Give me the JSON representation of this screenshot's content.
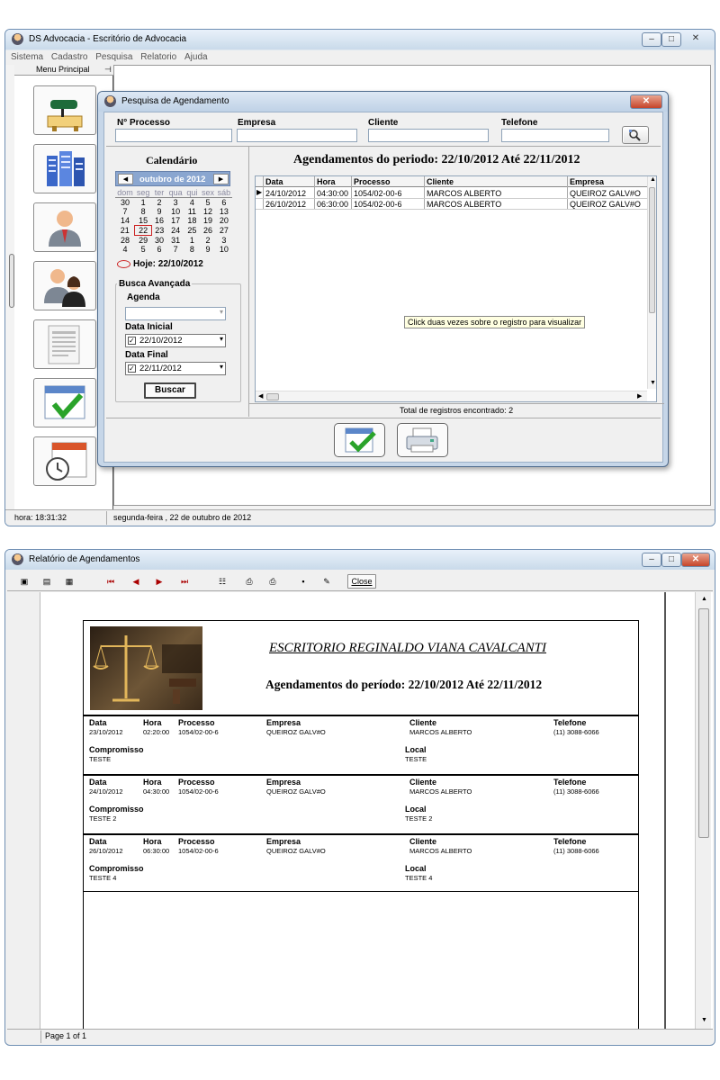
{
  "app": {
    "title": "DS Advocacia - Escritório de Advocacia",
    "menu": [
      "Sistema",
      "Cadastro",
      "Pesquisa",
      "Relatorio",
      "Ajuda"
    ],
    "side_panel_title": "Menu Principal",
    "pin": "⊣",
    "side_icons": [
      "desk-lamp-icon",
      "buildings-icon",
      "user-man-icon",
      "user-couple-icon",
      "document-icon",
      "calendar-check-icon",
      "calendar-clock-icon"
    ],
    "status": {
      "time": "hora:  18:31:32",
      "date": "segunda-feira ,  22 de outubro de 2012"
    },
    "win_buttons": [
      "–",
      "□",
      "✕"
    ]
  },
  "search": {
    "title": "Pesquisa de Agendamento",
    "close": "✕",
    "labels": {
      "processo": "N° Processo",
      "empresa": "Empresa",
      "cliente": "Cliente",
      "telefone": "Telefone"
    },
    "calendar": {
      "title": "Calendário",
      "month": "outubro de 2012",
      "prev": "◀",
      "next": "▶",
      "weekdays": [
        "dom",
        "seg",
        "ter",
        "qua",
        "qui",
        "sex",
        "sáb"
      ],
      "weeks": [
        [
          "30",
          "1",
          "2",
          "3",
          "4",
          "5",
          "6"
        ],
        [
          "7",
          "8",
          "9",
          "10",
          "11",
          "12",
          "13"
        ],
        [
          "14",
          "15",
          "16",
          "17",
          "18",
          "19",
          "20"
        ],
        [
          "21",
          "22",
          "23",
          "24",
          "25",
          "26",
          "27"
        ],
        [
          "28",
          "29",
          "30",
          "31",
          "1",
          "2",
          "3"
        ],
        [
          "4",
          "5",
          "6",
          "7",
          "8",
          "9",
          "10"
        ]
      ],
      "today": "Hoje: 22/10/2012"
    },
    "advanced": {
      "title": "Busca Avançada",
      "agenda_label": "Agenda",
      "agenda_value": "",
      "data_inicial_label": "Data Inicial",
      "data_inicial": "22/10/2012",
      "data_final_label": "Data Final",
      "data_final": "22/11/2012",
      "buscar": "Buscar"
    },
    "period_title": "Agendamentos  do periodo: 22/10/2012 Até 22/11/2012",
    "grid": {
      "columns": [
        "Data",
        "Hora",
        "Processo",
        "Cliente",
        "Empresa"
      ],
      "rows": [
        [
          "24/10/2012",
          "04:30:00",
          "1054/02-00-6",
          "MARCOS ALBERTO",
          "QUEIROZ GALV#O"
        ],
        [
          "26/10/2012",
          "06:30:00",
          "1054/02-00-6",
          "MARCOS ALBERTO",
          "QUEIROZ GALV#O"
        ]
      ]
    },
    "tooltip": "Click duas vezes sobre o registro para visualizar",
    "total": "Total de registros encontrado: 2"
  },
  "report": {
    "title": "Relatório de Agendamentos",
    "close_label": "Close",
    "page": "Page 1 of 1",
    "header": "ESCRITORIO REGINALDO VIANA CAVALCANTI",
    "period_title": "Agendamentos  do período: 22/10/2012 Até 22/11/2012",
    "field_labels": {
      "data": "Data",
      "hora": "Hora",
      "processo": "Processo",
      "empresa": "Empresa",
      "cliente": "Cliente",
      "telefone": "Telefone",
      "compromisso": "Compromisso",
      "local": "Local"
    },
    "records": [
      {
        "data": "23/10/2012",
        "hora": "02:20:00",
        "processo": "1054/02-00-6",
        "empresa": "QUEIROZ GALV#O",
        "cliente": "MARCOS ALBERTO",
        "telefone": "(11) 3088-6066",
        "compromisso": "TESTE",
        "local": "TESTE"
      },
      {
        "data": "24/10/2012",
        "hora": "04:30:00",
        "processo": "1054/02-00-6",
        "empresa": "QUEIROZ GALV#O",
        "cliente": "MARCOS ALBERTO",
        "telefone": "(11) 3088-6066",
        "compromisso": "TESTE 2",
        "local": "TESTE 2"
      },
      {
        "data": "26/10/2012",
        "hora": "06:30:00",
        "processo": "1054/02-00-6",
        "empresa": "QUEIROZ GALV#O",
        "cliente": "MARCOS ALBERTO",
        "telefone": "(11) 3088-6066",
        "compromisso": "TESTE 4",
        "local": "TESTE 4"
      }
    ]
  }
}
